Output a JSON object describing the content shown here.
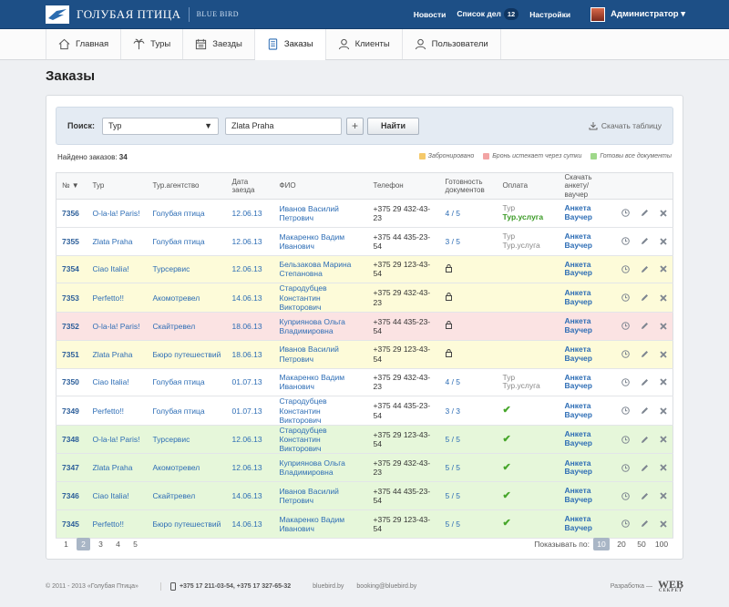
{
  "brand": {
    "name_ru": "ГОЛУБАЯ ПТИЦА",
    "name_en": "BLUE BIRD"
  },
  "topnav": {
    "news": "Новости",
    "tasks": "Список дел",
    "tasks_count": "12",
    "settings": "Настройки",
    "user": "Администратор ▾"
  },
  "tabs": [
    {
      "label": "Главная",
      "icon": "home-icon"
    },
    {
      "label": "Туры",
      "icon": "palm-icon"
    },
    {
      "label": "Заезды",
      "icon": "calendar-icon"
    },
    {
      "label": "Заказы",
      "icon": "document-icon",
      "active": true
    },
    {
      "label": "Клиенты",
      "icon": "client-icon"
    },
    {
      "label": "Пользователи",
      "icon": "user-icon"
    }
  ],
  "page": {
    "title": "Заказы"
  },
  "search": {
    "label": "Поиск:",
    "type_value": "Тур",
    "query_value": "Zlata Praha",
    "plus": "+",
    "find": "Найти",
    "download": "Скачать таблицу"
  },
  "found": {
    "label": "Найдено заказов:",
    "count": "34"
  },
  "legend": [
    {
      "label": "Забронировано",
      "color": "#f5c96a"
    },
    {
      "label": "Бронь истекает через сутки",
      "color": "#f2a4a4"
    },
    {
      "label": "Готовы все документы",
      "color": "#9fd88a"
    }
  ],
  "table": {
    "headers": [
      "№ ▼",
      "Тур",
      "Тур.агентство",
      "Дата заезда",
      "ФИО",
      "Телефон",
      "Готовность документов",
      "Оплата",
      "Скачать анкету/ваучер"
    ],
    "rows": [
      {
        "num": "7356",
        "tour": "O-la-la! Paris!",
        "agency": "Голубая птица",
        "date": "12.06.13",
        "name": "Иванов Василий Петрович",
        "phone": "+375 29 432-43-23",
        "ready": "4 / 5",
        "pay1": "Тур",
        "pay2": "Тур.услуга",
        "pay2_style": "green",
        "status": "white"
      },
      {
        "num": "7355",
        "tour": "Zlata Praha",
        "agency": "Голубая птица",
        "date": "12.06.13",
        "name": "Макаренко Вадим Иванович",
        "phone": "+375 44 435-23-54",
        "ready": "3 / 5",
        "pay1": "Тур",
        "pay2": "Тур.услуга",
        "pay2_style": "grey",
        "status": "white"
      },
      {
        "num": "7354",
        "tour": "Ciao Italia!",
        "agency": "Турсервис",
        "date": "12.06.13",
        "name": "Бельзакова Марина Степановна",
        "phone": "+375 29 123-43-54",
        "ready": "lock",
        "pay1": "",
        "pay2": "",
        "status": "yellow"
      },
      {
        "num": "7353",
        "tour": "Perfetto!!",
        "agency": "Акомотревел",
        "date": "14.06.13",
        "name": "Стародубцев Константин Викторович",
        "phone": "+375 29 432-43-23",
        "ready": "lock",
        "pay1": "",
        "pay2": "",
        "status": "yellow"
      },
      {
        "num": "7352",
        "tour": "O-la-la! Paris!",
        "agency": "Скайтревел",
        "date": "18.06.13",
        "name": "Куприянова Ольга Владимировна",
        "phone": "+375 44 435-23-54",
        "ready": "lock",
        "pay1": "",
        "pay2": "",
        "status": "pink"
      },
      {
        "num": "7351",
        "tour": "Zlata Praha",
        "agency": "Бюро путешествий",
        "date": "18.06.13",
        "name": "Иванов Василий Петрович",
        "phone": "+375 29 123-43-54",
        "ready": "lock",
        "pay1": "",
        "pay2": "",
        "status": "yellow"
      },
      {
        "num": "7350",
        "tour": "Ciao Italia!",
        "agency": "Голубая птица",
        "date": "01.07.13",
        "name": "Макаренко Вадим Иванович",
        "phone": "+375 29 432-43-23",
        "ready": "4 / 5",
        "pay1": "Тур",
        "pay2": "Тур.услуга",
        "pay2_style": "grey",
        "status": "white"
      },
      {
        "num": "7349",
        "tour": "Perfetto!!",
        "agency": "Голубая птица",
        "date": "01.07.13",
        "name": "Стародубцев Константин Викторович",
        "phone": "+375 44 435-23-54",
        "ready": "3 / 3",
        "pay1": "check",
        "pay2": "",
        "status": "white"
      },
      {
        "num": "7348",
        "tour": "O-la-la! Paris!",
        "agency": "Турсервис",
        "date": "12.06.13",
        "name": "Стародубцев Константин Викторович",
        "phone": "+375 29 123-43-54",
        "ready": "5 / 5",
        "pay1": "check",
        "pay2": "",
        "status": "green"
      },
      {
        "num": "7347",
        "tour": "Zlata Praha",
        "agency": "Акомотревел",
        "date": "12.06.13",
        "name": "Куприянова Ольга Владимировна",
        "phone": "+375 29 432-43-23",
        "ready": "5 / 5",
        "pay1": "check",
        "pay2": "",
        "status": "green"
      },
      {
        "num": "7346",
        "tour": "Ciao Italia!",
        "agency": "Скайтревел",
        "date": "14.06.13",
        "name": "Иванов Василий Петрович",
        "phone": "+375 44 435-23-54",
        "ready": "5 / 5",
        "pay1": "check",
        "pay2": "",
        "status": "green"
      },
      {
        "num": "7345",
        "tour": "Perfetto!!",
        "agency": "Бюро путешествий",
        "date": "14.06.13",
        "name": "Макаренко Вадим Иванович",
        "phone": "+375 29 123-43-54",
        "ready": "5 / 5",
        "pay1": "check",
        "pay2": "",
        "status": "green"
      }
    ],
    "doc_links": {
      "form": "Анкета",
      "voucher": "Ваучер"
    }
  },
  "pagination": {
    "pages": [
      "1",
      "2",
      "3",
      "4",
      "5"
    ],
    "current": "2"
  },
  "perpage": {
    "label": "Показывать по:",
    "options": [
      "10",
      "20",
      "50",
      "100"
    ],
    "current": "10"
  },
  "footer": {
    "copyright": "© 2011 - 2013 «Голубая Птица»",
    "phones": "+375 17 211-03-54, +375 17 327-65-32",
    "site": "bluebird.by",
    "email": "booking@bluebird.by",
    "dev_label": "Разработка —",
    "dev_logo_top": "WEB",
    "dev_logo_bottom": "СЕКРЕТ"
  }
}
